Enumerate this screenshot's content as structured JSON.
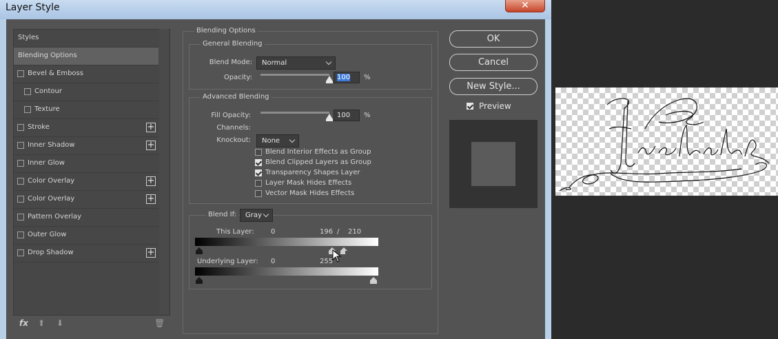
{
  "window": {
    "title": "Layer Style",
    "close_symbol": "✕"
  },
  "styles_list": {
    "items": [
      {
        "label": "Styles",
        "checkbox": false,
        "plus": false,
        "selected": false
      },
      {
        "label": "Blending Options",
        "checkbox": false,
        "plus": false,
        "selected": true
      },
      {
        "label": "Bevel & Emboss",
        "checkbox": true,
        "checked": false,
        "plus": false
      },
      {
        "label": "Contour",
        "checkbox": true,
        "checked": false,
        "plus": false,
        "indent": true
      },
      {
        "label": "Texture",
        "checkbox": true,
        "checked": false,
        "plus": false,
        "indent": true
      },
      {
        "label": "Stroke",
        "checkbox": true,
        "checked": false,
        "plus": true
      },
      {
        "label": "Inner Shadow",
        "checkbox": true,
        "checked": false,
        "plus": true
      },
      {
        "label": "Inner Glow",
        "checkbox": true,
        "checked": false,
        "plus": false
      },
      {
        "label": "Color Overlay",
        "checkbox": true,
        "checked": false,
        "plus": true
      },
      {
        "label": "Color Overlay",
        "checkbox": true,
        "checked": false,
        "plus": true
      },
      {
        "label": "Pattern Overlay",
        "checkbox": true,
        "checked": false,
        "plus": false
      },
      {
        "label": "Outer Glow",
        "checkbox": true,
        "checked": false,
        "plus": false
      },
      {
        "label": "Drop Shadow",
        "checkbox": true,
        "checked": false,
        "plus": true
      }
    ],
    "plus_symbol": "+",
    "footer": {
      "fx_label": "fx",
      "up_symbol": "⬆",
      "down_symbol": "⬇",
      "trash_symbol": "🗑"
    }
  },
  "blending": {
    "section_title": "Blending Options",
    "general": {
      "title": "General Blending",
      "blend_mode_label": "Blend Mode:",
      "blend_mode_value": "Normal",
      "opacity_label": "Opacity:",
      "opacity_value": "100",
      "opacity_unit": "%",
      "opacity_fraction": 1.0
    },
    "advanced": {
      "title": "Advanced Blending",
      "fill_opacity_label": "Fill Opacity:",
      "fill_opacity_value": "100",
      "fill_opacity_unit": "%",
      "fill_opacity_fraction": 1.0,
      "channels_label": "Channels:",
      "knockout_label": "Knockout:",
      "knockout_value": "None",
      "checks": [
        {
          "label": "Blend Interior Effects as Group",
          "checked": false
        },
        {
          "label": "Blend Clipped Layers as Group",
          "checked": true
        },
        {
          "label": "Transparency Shapes Layer",
          "checked": true
        },
        {
          "label": "Layer Mask Hides Effects",
          "checked": false
        },
        {
          "label": "Vector Mask Hides Effects",
          "checked": false
        }
      ]
    },
    "blend_if": {
      "label": "Blend If:",
      "channel": "Gray",
      "this_layer_label": "This Layer:",
      "this_layer_low": "0",
      "this_layer_high_a": "196",
      "this_layer_sep": "/",
      "this_layer_high_b": "210",
      "underlying_label": "Underlying Layer:",
      "underlying_low": "0",
      "underlying_high": "255"
    }
  },
  "buttons": {
    "ok": "OK",
    "cancel": "Cancel",
    "new_style": "New Style...",
    "preview_label": "Preview",
    "preview_checked": true
  },
  "canvas": {
    "signature_text": "Elizabeth R"
  },
  "colors": {
    "dialog_bg": "#535353",
    "selected_row": "#616161",
    "highlight": "#3b7ad9"
  }
}
